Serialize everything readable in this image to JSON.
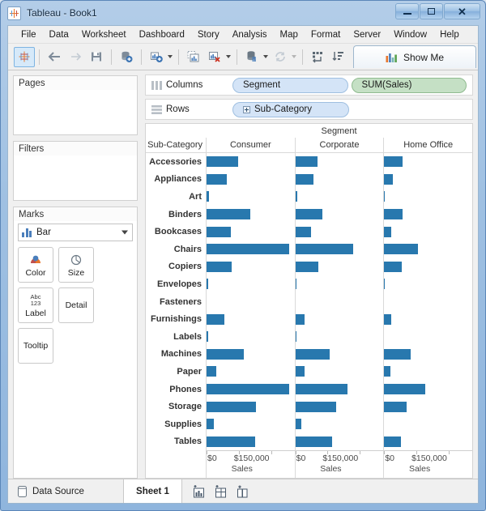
{
  "window": {
    "title": "Tableau - Book1",
    "app_icon": "tableau-icon",
    "minimize_label": "Minimize",
    "maximize_label": "Maximize",
    "close_label": "Close"
  },
  "menu": {
    "items": [
      {
        "label": "File"
      },
      {
        "label": "Data"
      },
      {
        "label": "Worksheet"
      },
      {
        "label": "Dashboard"
      },
      {
        "label": "Story"
      },
      {
        "label": "Analysis"
      },
      {
        "label": "Map"
      },
      {
        "label": "Format"
      },
      {
        "label": "Server"
      },
      {
        "label": "Window"
      },
      {
        "label": "Help"
      }
    ]
  },
  "toolbar": {
    "buttons": [
      {
        "name": "tableau-logo-button",
        "icon": "tableau-sparkle-icon"
      },
      {
        "name": "back-button",
        "icon": "arrow-left-icon"
      },
      {
        "name": "forward-button",
        "icon": "arrow-right-icon"
      },
      {
        "name": "save-button",
        "icon": "floppy-disk-icon"
      },
      {
        "name": "connect-data-button",
        "icon": "add-data-source-icon"
      },
      {
        "name": "new-worksheet-button",
        "icon": "new-worksheet-icon"
      },
      {
        "name": "duplicate-sheet-button",
        "icon": "duplicate-sheet-icon"
      },
      {
        "name": "clear-sheet-button",
        "icon": "clear-sheet-icon"
      },
      {
        "name": "pause-updates-button",
        "icon": "pause-data-icon"
      },
      {
        "name": "refresh-button",
        "icon": "refresh-icon"
      },
      {
        "name": "swap-rows-columns-button",
        "icon": "swap-axis-icon"
      },
      {
        "name": "sort-ascending-button",
        "icon": "sort-asc-icon"
      }
    ],
    "show_me_label": "Show Me",
    "show_me_icon": "show-me-bars-icon"
  },
  "cards": {
    "pages": {
      "title": "Pages"
    },
    "filters": {
      "title": "Filters"
    },
    "marks": {
      "title": "Marks",
      "mark_type": "Bar",
      "mark_type_icon": "bar-mark-icon",
      "shelves": [
        {
          "label": "Color",
          "icon": "color-palette-icon"
        },
        {
          "label": "Size",
          "icon": "size-circle-icon"
        },
        {
          "label": "Label",
          "icon": "abc-123-icon",
          "icon_top": "Abc",
          "icon_bottom": "123"
        },
        {
          "label": "Detail",
          "icon": "detail-icon"
        },
        {
          "label": "Tooltip",
          "icon": "tooltip-icon"
        }
      ]
    }
  },
  "shelves": {
    "columns": {
      "label": "Columns",
      "icon": "columns-icon",
      "pills": [
        {
          "text": "Segment",
          "type": "dimension",
          "expandable": false
        },
        {
          "text": "SUM(Sales)",
          "type": "measure",
          "expandable": false
        }
      ]
    },
    "rows": {
      "label": "Rows",
      "icon": "rows-icon",
      "pills": [
        {
          "text": "Sub-Category",
          "type": "dimension",
          "expandable": true
        }
      ]
    }
  },
  "chart_data": {
    "type": "bar",
    "title": "",
    "column_field_title": "Segment",
    "row_field_title": "Sub-Category",
    "xlabel": "Sales",
    "ylabel": "Sub-Category",
    "xlim": [
      0,
      205000
    ],
    "xticks": [
      0,
      150000
    ],
    "xticklabels": [
      "$0",
      "$150,000"
    ],
    "grid": false,
    "legend": "none",
    "bar_color": "#2878ae",
    "categories": [
      "Accessories",
      "Appliances",
      "Art",
      "Binders",
      "Bookcases",
      "Chairs",
      "Copiers",
      "Envelopes",
      "Fasteners",
      "Furnishings",
      "Labels",
      "Machines",
      "Paper",
      "Phones",
      "Storage",
      "Supplies",
      "Tables"
    ],
    "series": [
      {
        "name": "Consumer",
        "values": [
          73000,
          48000,
          5000,
          102000,
          56000,
          193000,
          59000,
          4000,
          0,
          41000,
          3000,
          87000,
          23000,
          192000,
          115000,
          17000,
          114000
        ]
      },
      {
        "name": "Corporate",
        "values": [
          51000,
          42000,
          4000,
          62000,
          37000,
          135000,
          54000,
          3000,
          0,
          22000,
          2000,
          80000,
          21000,
          121000,
          95000,
          13000,
          86000
        ]
      },
      {
        "name": "Home Office",
        "values": [
          43000,
          21000,
          2000,
          42000,
          16000,
          79000,
          41000,
          2000,
          0,
          17000,
          0,
          62000,
          15000,
          95000,
          52000,
          0,
          39000
        ]
      }
    ]
  },
  "statusbar": {
    "data_source_label": "Data Source",
    "data_source_icon": "database-icon",
    "sheets": [
      {
        "label": "Sheet 1",
        "active": true
      }
    ],
    "new_buttons": [
      {
        "name": "new-worksheet-tab-button",
        "icon": "new-worksheet-tab-icon"
      },
      {
        "name": "new-dashboard-tab-button",
        "icon": "new-dashboard-tab-icon"
      },
      {
        "name": "new-story-tab-button",
        "icon": "new-story-tab-icon"
      }
    ]
  }
}
